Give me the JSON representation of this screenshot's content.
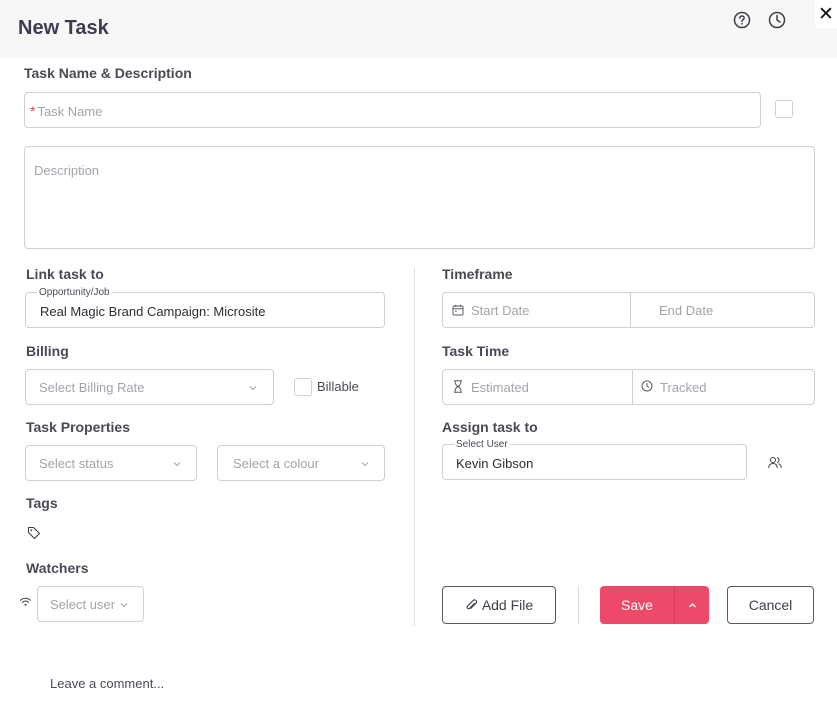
{
  "header": {
    "title": "New Task"
  },
  "task": {
    "section_label": "Task Name & Description",
    "name_placeholder": "Task Name",
    "required_mark": "*",
    "description_placeholder": "Description"
  },
  "link": {
    "section_label": "Link task to",
    "float_label": "Opportunity/Job",
    "value": "Real Magic Brand Campaign: Microsite"
  },
  "timeframe": {
    "section_label": "Timeframe",
    "start_placeholder": "Start Date",
    "end_placeholder": "End Date"
  },
  "billing": {
    "section_label": "Billing",
    "rate_placeholder": "Select Billing Rate",
    "billable_label": "Billable"
  },
  "task_time": {
    "section_label": "Task Time",
    "estimated_placeholder": "Estimated",
    "tracked_placeholder": "Tracked"
  },
  "properties": {
    "section_label": "Task Properties",
    "status_placeholder": "Select status",
    "colour_placeholder": "Select a colour"
  },
  "assign": {
    "section_label": "Assign task to",
    "float_label": "Select User",
    "value": "Kevin Gibson"
  },
  "tags": {
    "section_label": "Tags"
  },
  "watchers": {
    "section_label": "Watchers",
    "placeholder": "Select user"
  },
  "actions": {
    "add_file": "Add File",
    "save": "Save",
    "cancel": "Cancel"
  },
  "comment": {
    "placeholder": "Leave a comment..."
  },
  "colors": {
    "accent": "#ec4a68",
    "required": "#e23b56"
  }
}
